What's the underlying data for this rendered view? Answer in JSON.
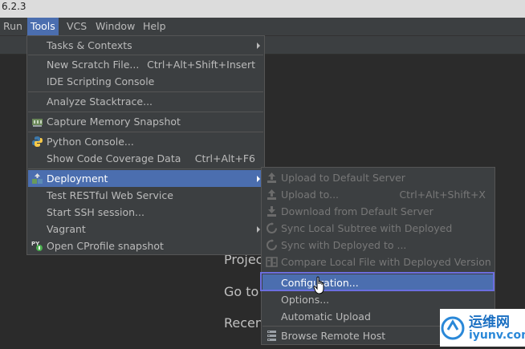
{
  "window": {
    "title": "6.2.3"
  },
  "menubar": {
    "items": [
      "Run",
      "Tools",
      "VCS",
      "Window",
      "Help"
    ]
  },
  "welcome": {
    "hints": [
      "Projec",
      "Go to",
      "Recen"
    ]
  },
  "tools_menu": {
    "items": [
      {
        "label": "Tasks & Contexts",
        "shortcut": "",
        "submenu": true
      },
      {
        "label": "New Scratch File...",
        "shortcut": "Ctrl+Alt+Shift+Insert"
      },
      {
        "label": "IDE Scripting Console",
        "shortcut": ""
      },
      {
        "label": "Analyze Stacktrace...",
        "shortcut": ""
      },
      {
        "label": "Capture Memory Snapshot",
        "shortcut": "",
        "icon": "memory-snapshot-icon"
      },
      {
        "label": "Python Console...",
        "shortcut": "",
        "icon": "python-icon"
      },
      {
        "label": "Show Code Coverage Data",
        "shortcut": "Ctrl+Alt+F6"
      },
      {
        "label": "Deployment",
        "shortcut": "",
        "submenu": true,
        "selected": true,
        "icon": "deployment-icon"
      },
      {
        "label": "Test RESTful Web Service",
        "shortcut": ""
      },
      {
        "label": "Start SSH session...",
        "shortcut": ""
      },
      {
        "label": "Vagrant",
        "shortcut": "",
        "submenu": true
      },
      {
        "label": "Open CProfile snapshot",
        "shortcut": "",
        "icon": "cprofile-icon"
      }
    ]
  },
  "deployment_menu": {
    "items": [
      {
        "label": "Upload to Default Server",
        "shortcut": "",
        "enabled": false,
        "icon": "upload-icon"
      },
      {
        "label": "Upload to...",
        "shortcut": "Ctrl+Alt+Shift+X",
        "enabled": false,
        "icon": "upload-icon"
      },
      {
        "label": "Download from Default Server",
        "shortcut": "",
        "enabled": false,
        "icon": "download-icon"
      },
      {
        "label": "Sync Local Subtree with Deployed",
        "shortcut": "",
        "enabled": false,
        "icon": "sync-icon"
      },
      {
        "label": "Sync with Deployed to ...",
        "shortcut": "",
        "enabled": false,
        "icon": "sync-icon"
      },
      {
        "label": "Compare Local File with Deployed Version",
        "shortcut": "",
        "enabled": false,
        "icon": "compare-icon"
      },
      {
        "label": "Configuration...",
        "shortcut": "",
        "enabled": true,
        "highlighted": true
      },
      {
        "label": "Options...",
        "shortcut": "",
        "enabled": true
      },
      {
        "label": "Automatic Upload",
        "shortcut": "",
        "enabled": true
      },
      {
        "label": "Browse Remote Host",
        "shortcut": "",
        "enabled": true,
        "icon": "remote-host-icon"
      }
    ]
  },
  "watermark": {
    "text": "运维网",
    "url_text": "iyunv.com"
  },
  "colors": {
    "accent": "#4b6eaf",
    "highlight_border": "#6b6ee0",
    "menu_bg": "#3c3f41"
  }
}
